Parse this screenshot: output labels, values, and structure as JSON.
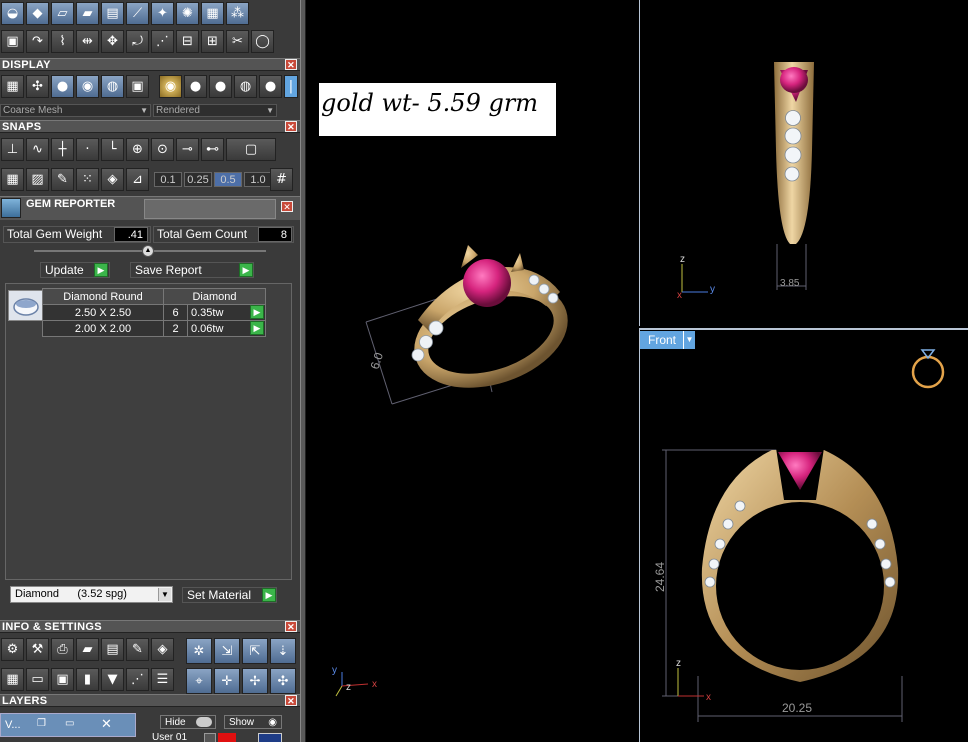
{
  "sections": {
    "display": "DISPLAY",
    "snaps": "SNAPS",
    "gem_reporter": "GEM REPORTER",
    "info_settings": "INFO & SETTINGS",
    "layers": "LAYERS"
  },
  "display": {
    "mesh_value": "Coarse Mesh",
    "render_value": "Rendered"
  },
  "snaps": {
    "values": [
      "0.1",
      "0.25",
      "0.5",
      "1.0"
    ],
    "active_value": "0.5"
  },
  "gem_reporter": {
    "total_gem_weight_label": "Total Gem Weight",
    "total_gem_weight": ".41",
    "total_gem_count_label": "Total Gem Count",
    "total_gem_count": "8",
    "update_label": "Update",
    "save_report_label": "Save Report",
    "table_headers": [
      "Diamond Round",
      "Diamond"
    ],
    "rows": [
      {
        "size": "2.50 X 2.50",
        "count": "6",
        "weight": "0.35tw"
      },
      {
        "size": "2.00 X 2.00",
        "count": "2",
        "weight": "0.06tw"
      }
    ],
    "material_value": "Diamond      (3.52 spg)",
    "set_material_label": "Set Material"
  },
  "layers": {
    "hide_label": "Hide",
    "show_label": "Show",
    "user_layer": "User 01",
    "view_stub": "V..."
  },
  "viewports": {
    "annotation": "gold wt- 5.59 grm",
    "front_label": "Front",
    "side_dim": "3.85",
    "height_dim": "24.64",
    "width_dim": "20.25",
    "persp_dim": "6.0",
    "axis_x": "x",
    "axis_y": "y",
    "axis_z": "z"
  },
  "colors": {
    "gold": "#c9a56a",
    "ruby": "#d6247e",
    "viewport_bg": "#000000",
    "panel_bg": "#3a3a3a",
    "accent_blue": "#62a5e0"
  }
}
